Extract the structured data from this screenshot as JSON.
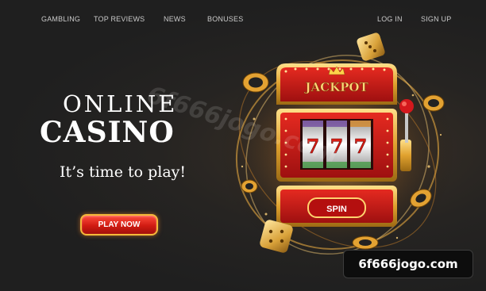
{
  "nav": {
    "gambling": "GAMBLING",
    "top_reviews": "TOP REVIEWS",
    "news": "NEWS",
    "bonuses": "BONUSES",
    "login": "LOG IN",
    "signup": "SIGN UP"
  },
  "hero": {
    "line1": "ONLINE",
    "line2": "CASINO",
    "tagline": "It’s time to play!",
    "cta": "PLAY NOW"
  },
  "slot_machine": {
    "sign": "JACKPOT",
    "reels": [
      "7",
      "7",
      "7"
    ],
    "spin_label": "SPIN"
  },
  "watermark": "6f666jogo.com",
  "badge": "6f666jogo.com",
  "colors": {
    "background": "#242424",
    "machine_red": "#c8191a",
    "gold": "#f2b33c",
    "cta_red": "#d11b12"
  },
  "icons": [
    "dice-icon",
    "casino-chip-icon",
    "crown-icon",
    "lever-icon"
  ]
}
